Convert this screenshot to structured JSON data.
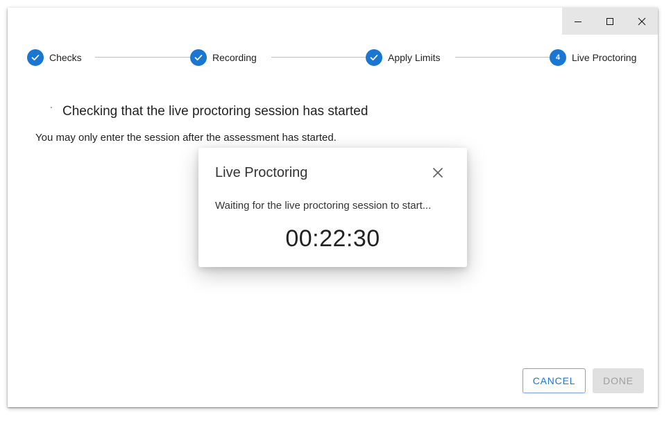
{
  "window_controls": {
    "minimize_icon": "minimize-icon",
    "maximize_icon": "maximize-icon",
    "close_icon": "close-icon"
  },
  "stepper": {
    "steps": [
      {
        "label": "Checks",
        "state": "completed",
        "icon": "check-icon"
      },
      {
        "label": "Recording",
        "state": "completed",
        "icon": "check-icon"
      },
      {
        "label": "Apply Limits",
        "state": "completed",
        "icon": "check-icon"
      },
      {
        "label": "Live Proctoring",
        "state": "active",
        "number": "4"
      }
    ],
    "accent_color": "#1976d2"
  },
  "main": {
    "heading": "Checking that the live proctoring session has started",
    "note": "You may only enter the session after the assessment has started."
  },
  "dialog": {
    "title": "Live Proctoring",
    "message": "Waiting for the live proctoring session to start...",
    "timer": "00:22:30",
    "close_icon": "close-icon"
  },
  "footer": {
    "cancel_label": "CANCEL",
    "done_label": "DONE",
    "done_disabled": true
  }
}
